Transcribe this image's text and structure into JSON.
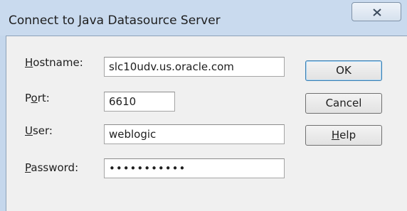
{
  "window": {
    "title": "Connect to Java Datasource Server",
    "close_icon": "close-icon"
  },
  "form": {
    "hostname": {
      "label_accel": "H",
      "label_rest": "ostname:",
      "value": "slc10udv.us.oracle.com"
    },
    "port": {
      "label_pre": "P",
      "label_accel": "o",
      "label_rest": "rt:",
      "value": "6610"
    },
    "user": {
      "label_accel": "U",
      "label_rest": "ser:",
      "value": "weblogic"
    },
    "password": {
      "label_accel": "P",
      "label_rest": "assword:",
      "value": "•••••••••••"
    }
  },
  "buttons": {
    "ok": "OK",
    "cancel": "Cancel",
    "help_accel": "H",
    "help_rest": "elp"
  }
}
